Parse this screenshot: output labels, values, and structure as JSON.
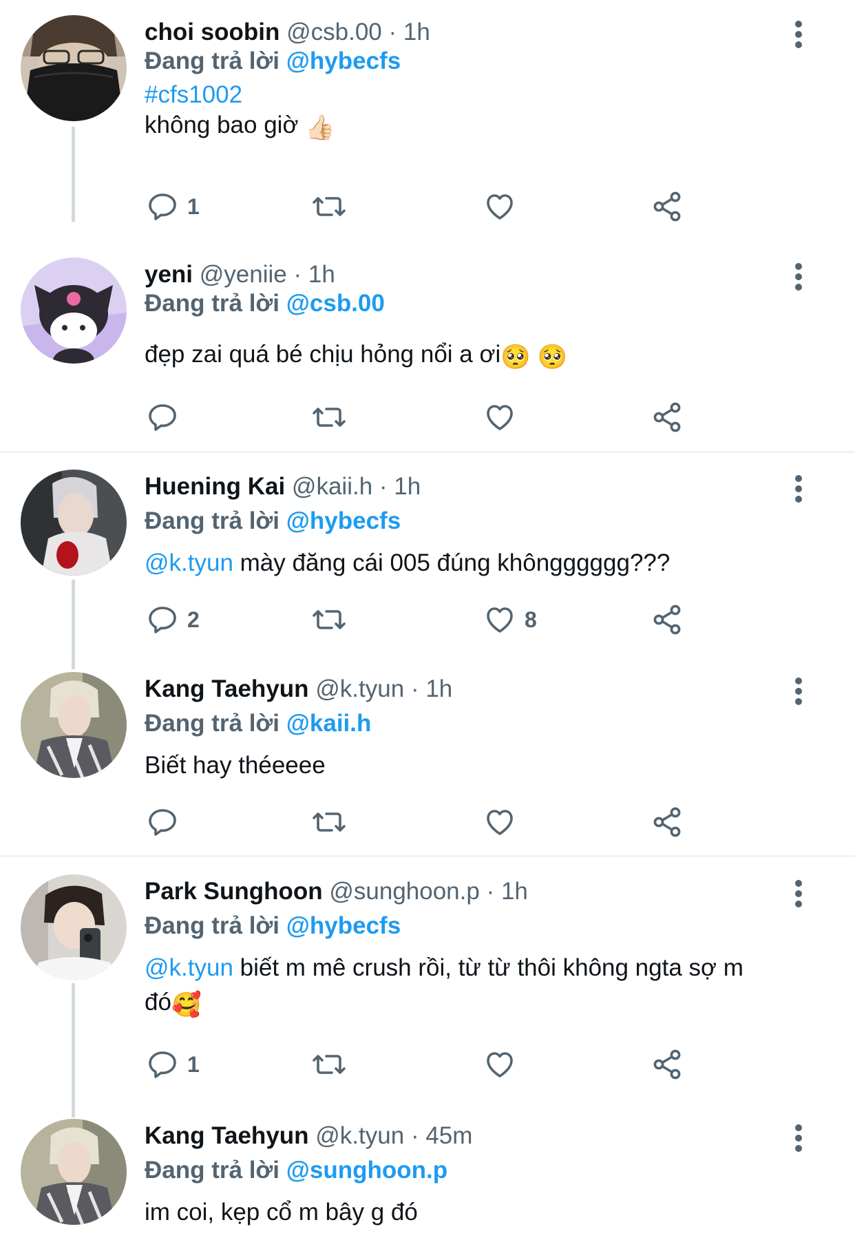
{
  "tweets": [
    {
      "name": "choi soobin",
      "handle": "@csb.00",
      "dot": "·",
      "time": "1h",
      "replying_label": "Đang trả lời",
      "replying_to": "@hybecfs",
      "hashtag": "#cfs1002",
      "text": "không bao giờ",
      "emoji": "👍🏻",
      "reply_count": "1",
      "like_count": ""
    },
    {
      "name": "yeni",
      "handle": "@yeniie",
      "dot": "·",
      "time": "1h",
      "replying_label": "Đang trả lời",
      "replying_to": "@csb.00",
      "text": "đẹp zai quá bé chịu hỏng nổi a ơi",
      "emoji": "🥺 🥺",
      "reply_count": "",
      "like_count": ""
    },
    {
      "name": "Huening Kai",
      "handle": "@kaii.h",
      "dot": "·",
      "time": "1h",
      "replying_label": "Đang trả lời",
      "replying_to": "@hybecfs",
      "mention": "@k.tyun",
      "text": "mày đăng cái 005 đúng khôngggggg???",
      "reply_count": "2",
      "like_count": "8"
    },
    {
      "name": "Kang Taehyun",
      "handle": "@k.tyun",
      "dot": "·",
      "time": "1h",
      "replying_label": "Đang trả lời",
      "replying_to": "@kaii.h",
      "text": "Biết hay théeeee",
      "reply_count": "",
      "like_count": ""
    },
    {
      "name": "Park Sunghoon",
      "handle": "@sunghoon.p",
      "dot": "·",
      "time": "1h",
      "replying_label": "Đang trả lời",
      "replying_to": "@hybecfs",
      "mention": "@k.tyun",
      "text": "biết m mê crush rồi, từ từ thôi không ngta sợ m",
      "text_line2": "đó",
      "emoji": "🥰",
      "reply_count": "1",
      "like_count": ""
    },
    {
      "name": "Kang Taehyun",
      "handle": "@k.tyun",
      "dot": "·",
      "time": "45m",
      "replying_label": "Đang trả lời",
      "replying_to": "@sunghoon.p",
      "text": "im coi, kẹp cổ m bây g đó"
    }
  ],
  "icons": {
    "reply": "reply-icon",
    "retweet": "retweet-icon",
    "like": "heart-icon",
    "share": "share-icon",
    "more": "more-vertical-icon"
  },
  "colors": {
    "accent": "#1d9bf0",
    "secondary_text": "#536471",
    "primary_text": "#0f1419",
    "icon": "#536471",
    "thread_line": "#cfd9de",
    "divider": "#eff3f4"
  }
}
